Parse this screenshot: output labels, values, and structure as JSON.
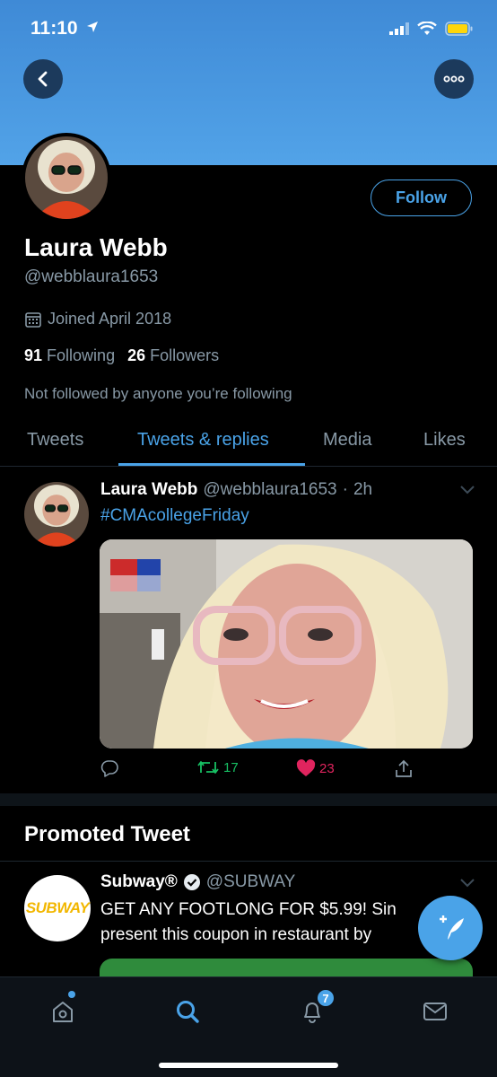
{
  "status": {
    "time": "11:10"
  },
  "profile": {
    "name": "Laura Webb",
    "handle": "@webblaura1653",
    "joined": "Joined April 2018",
    "following_count": "91",
    "following_label": "Following",
    "followers_count": "26",
    "followers_label": "Followers",
    "not_followed": "Not followed by anyone you’re following",
    "follow_label": "Follow"
  },
  "tabs": [
    {
      "label": "Tweets"
    },
    {
      "label": "Tweets & replies"
    },
    {
      "label": "Media"
    },
    {
      "label": "Likes"
    }
  ],
  "tweet": {
    "name": "Laura Webb",
    "handle": "@webblaura1653",
    "sep": "·",
    "time": "2h",
    "hashtag": "#CMAcollegeFriday",
    "retweets": "17",
    "likes": "23"
  },
  "promoted": {
    "title": "Promoted Tweet",
    "name": "Subway®",
    "handle": "@SUBWAY",
    "logo_text": "SUBWAY",
    "line1": "GET ANY FOOTLONG FOR $5.99! Sin",
    "line2": "present this coupon in restaurant by"
  },
  "nav": {
    "notifications_badge": "7"
  },
  "colors": {
    "accent": "#4aa3e8",
    "retweet": "#17bf63",
    "like": "#e0245e",
    "background": "#000000"
  }
}
